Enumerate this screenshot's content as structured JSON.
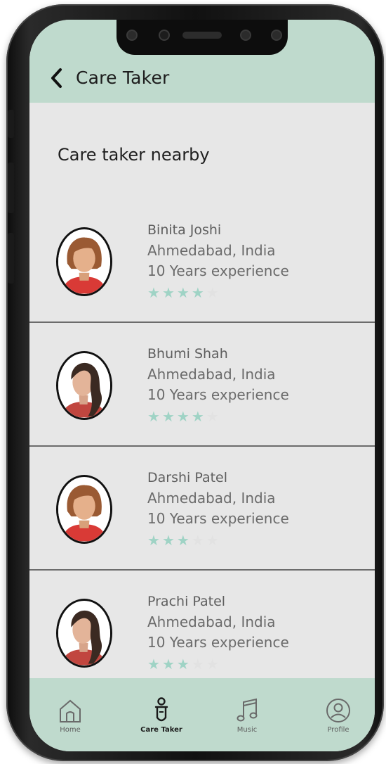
{
  "header": {
    "title": "Care Taker"
  },
  "section_title": "Care taker nearby",
  "caretakers": [
    {
      "name": "Binita Joshi",
      "location": "Ahmedabad, India",
      "experience": "10 Years experience",
      "rating": 4,
      "max_rating": 5,
      "avatar": "short-hair-avatar"
    },
    {
      "name": "Bhumi Shah",
      "location": "Ahmedabad, India",
      "experience": "10 Years experience",
      "rating": 4,
      "max_rating": 5,
      "avatar": "long-hair-avatar"
    },
    {
      "name": "Darshi Patel",
      "location": "Ahmedabad, India",
      "experience": "10 Years experience",
      "rating": 3,
      "max_rating": 5,
      "avatar": "short-hair-avatar"
    },
    {
      "name": "Prachi Patel",
      "location": "Ahmedabad, India",
      "experience": "10 Years experience",
      "rating": 3,
      "max_rating": 5,
      "avatar": "long-hair-avatar"
    }
  ],
  "nav": [
    {
      "label": "Home",
      "icon": "home-icon",
      "active": false
    },
    {
      "label": "Care Taker",
      "icon": "care-taker-icon",
      "active": true
    },
    {
      "label": "Music",
      "icon": "music-icon",
      "active": false
    },
    {
      "label": "Profile",
      "icon": "profile-icon",
      "active": false
    }
  ],
  "colors": {
    "accent": "#bfdacd",
    "star_on": "#9fd3c5",
    "star_off": "#e2e2e2",
    "background": "#e7e7e7"
  }
}
